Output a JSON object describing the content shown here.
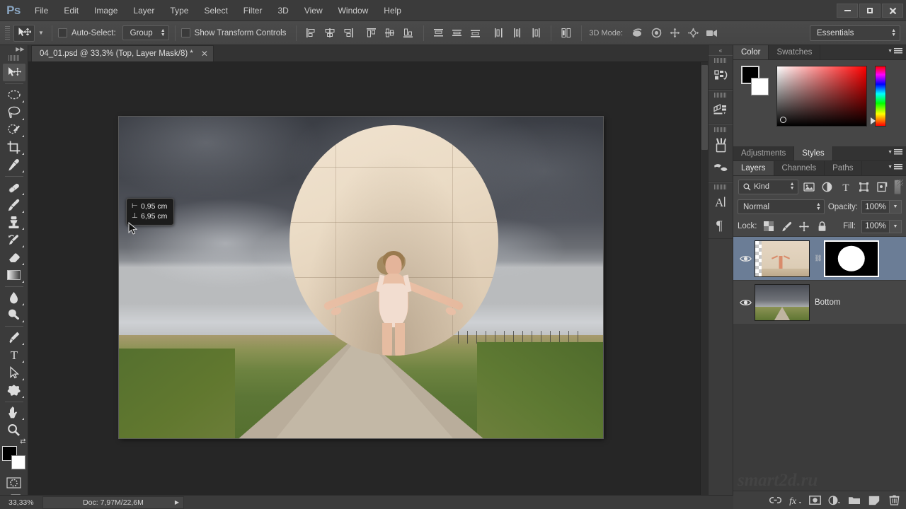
{
  "app": {
    "name": "Adobe Photoshop",
    "logo_text": "Ps"
  },
  "menubar": {
    "items": [
      {
        "label": "File"
      },
      {
        "label": "Edit"
      },
      {
        "label": "Image"
      },
      {
        "label": "Layer"
      },
      {
        "label": "Type"
      },
      {
        "label": "Select"
      },
      {
        "label": "Filter"
      },
      {
        "label": "3D"
      },
      {
        "label": "View"
      },
      {
        "label": "Window"
      },
      {
        "label": "Help"
      }
    ],
    "window_controls": [
      {
        "name": "minimize",
        "glyph": "–"
      },
      {
        "name": "maximize",
        "glyph": "□"
      },
      {
        "name": "close",
        "glyph": "✕"
      }
    ]
  },
  "options_bar": {
    "active_tool": "move-tool",
    "auto_select_label": "Auto-Select:",
    "auto_select_checked": false,
    "auto_select_scope": "Group",
    "show_transform_label": "Show Transform Controls",
    "show_transform_checked": false,
    "align_icons": [
      "align-left-edges",
      "align-horizontal-centers",
      "align-right-edges",
      "align-top-edges",
      "align-vertical-centers",
      "align-bottom-edges"
    ],
    "distribute_icons": [
      "distribute-top-edges",
      "distribute-vertical-centers",
      "distribute-bottom-edges",
      "distribute-left-edges",
      "distribute-horizontal-centers",
      "distribute-right-edges"
    ],
    "auto_align_icon": "auto-align-layers",
    "mode3d_label": "3D Mode:",
    "mode3d_icons": [
      "rotate-3d-object",
      "roll-3d-object",
      "drag-3d-object",
      "slide-3d-object",
      "scale-3d-object"
    ],
    "workspace": "Essentials"
  },
  "toolbar": {
    "tools": [
      {
        "name": "move-tool",
        "active": true,
        "has_flyout": false
      },
      {
        "name": "rectangular-marquee-tool",
        "active": false,
        "has_flyout": true
      },
      {
        "name": "lasso-tool",
        "active": false,
        "has_flyout": true
      },
      {
        "name": "quick-selection-tool",
        "active": false,
        "has_flyout": true
      },
      {
        "name": "crop-tool",
        "active": false,
        "has_flyout": true
      },
      {
        "name": "eyedropper-tool",
        "active": false,
        "has_flyout": true
      },
      {
        "name": "spot-healing-brush-tool",
        "active": false,
        "has_flyout": true
      },
      {
        "name": "brush-tool",
        "active": false,
        "has_flyout": true
      },
      {
        "name": "clone-stamp-tool",
        "active": false,
        "has_flyout": true
      },
      {
        "name": "history-brush-tool",
        "active": false,
        "has_flyout": true
      },
      {
        "name": "eraser-tool",
        "active": false,
        "has_flyout": true
      },
      {
        "name": "gradient-tool",
        "active": false,
        "has_flyout": true
      },
      {
        "name": "blur-tool",
        "active": false,
        "has_flyout": true
      },
      {
        "name": "dodge-tool",
        "active": false,
        "has_flyout": true
      },
      {
        "name": "pen-tool",
        "active": false,
        "has_flyout": true
      },
      {
        "name": "horizontal-type-tool",
        "active": false,
        "has_flyout": true
      },
      {
        "name": "path-selection-tool",
        "active": false,
        "has_flyout": true
      },
      {
        "name": "custom-shape-tool",
        "active": false,
        "has_flyout": true
      },
      {
        "name": "hand-tool",
        "active": false,
        "has_flyout": true
      },
      {
        "name": "zoom-tool",
        "active": false,
        "has_flyout": false
      }
    ],
    "foreground_color": "#000000",
    "background_color": "#ffffff",
    "quick_mask_icon": "edit-in-quick-mask-mode",
    "screen_mode_icon": "change-screen-mode"
  },
  "document": {
    "tab_title": "04_01.psd @ 33,3% (Top, Layer Mask/8) *",
    "close_glyph": "✕"
  },
  "canvas": {
    "measure_tooltip": {
      "x_icon": "horizontal-offset-icon",
      "x_value": "0,95 cm",
      "y_icon": "vertical-offset-icon",
      "y_value": "6,95 cm"
    },
    "artwork_description": "Stormy sky over prairie dirt road with circular masked layer revealing a woman with outstretched arms against a beige wall"
  },
  "icon_dock": {
    "collapse_glyph": "«",
    "groups": [
      {
        "icons": [
          {
            "name": "history-panel-icon"
          }
        ]
      },
      {
        "icons": [
          {
            "name": "3d-panel-icon"
          }
        ]
      },
      {
        "icons": [
          {
            "name": "brush-presets-panel-icon"
          },
          {
            "name": "brush-panel-icon"
          }
        ]
      },
      {
        "icons": [
          {
            "name": "character-panel-icon"
          },
          {
            "name": "paragraph-panel-icon"
          }
        ]
      }
    ]
  },
  "panels": {
    "color_group": {
      "tabs": [
        {
          "label": "Color",
          "active": true
        },
        {
          "label": "Swatches",
          "active": false
        }
      ],
      "menu_icon": "panel-menu-icon",
      "foreground_color": "#000000",
      "background_color": "#ffffff",
      "picker_hue": "#ff0000"
    },
    "adjustments_group": {
      "tabs": [
        {
          "label": "Adjustments",
          "active": false
        },
        {
          "label": "Styles",
          "active": true
        }
      ],
      "menu_icon": "panel-menu-icon"
    },
    "layers_group": {
      "tabs": [
        {
          "label": "Layers",
          "active": true
        },
        {
          "label": "Channels",
          "active": false
        },
        {
          "label": "Paths",
          "active": false
        }
      ],
      "menu_icon": "panel-menu-icon",
      "filter": {
        "kind_label": "Kind",
        "search_icon": "filter-search-icon",
        "type_filters": [
          {
            "name": "filter-pixel-layers-icon"
          },
          {
            "name": "filter-adjustment-layers-icon"
          },
          {
            "name": "filter-type-layers-icon"
          },
          {
            "name": "filter-shape-layers-icon"
          },
          {
            "name": "filter-smart-object-layers-icon"
          }
        ],
        "toggle_name": "filter-enable-toggle"
      },
      "blend_mode": "Normal",
      "opacity_label": "Opacity:",
      "opacity_value": "100%",
      "lock_label": "Lock:",
      "lock_icons": [
        {
          "name": "lock-transparent-pixels-icon"
        },
        {
          "name": "lock-image-pixels-icon"
        },
        {
          "name": "lock-position-icon"
        },
        {
          "name": "lock-all-icon"
        }
      ],
      "fill_label": "Fill:",
      "fill_value": "100%",
      "layers": [
        {
          "name": "",
          "visible": true,
          "selected": true,
          "has_mask": true,
          "mask_selected": true,
          "thumbnail": "figure-against-wall-transparent",
          "mask_thumbnail": "black-with-white-circle",
          "eye_icon": "eye-icon"
        },
        {
          "name": "Bottom",
          "visible": true,
          "selected": false,
          "has_mask": false,
          "mask_selected": false,
          "thumbnail": "stormy-road-landscape",
          "eye_icon": "eye-icon"
        }
      ],
      "bottom_buttons": [
        {
          "name": "link-layers-icon"
        },
        {
          "name": "add-layer-style-icon",
          "label": "fx"
        },
        {
          "name": "add-layer-mask-icon"
        },
        {
          "name": "new-adjustment-layer-icon"
        },
        {
          "name": "new-group-icon"
        },
        {
          "name": "new-layer-icon"
        },
        {
          "name": "delete-layer-icon"
        }
      ]
    },
    "watermark": "smart2d.ru"
  },
  "status_bar": {
    "zoom": "33,33%",
    "doc_info": "Doc: 7,97M/22,6M",
    "expand_glyph": "▶"
  }
}
